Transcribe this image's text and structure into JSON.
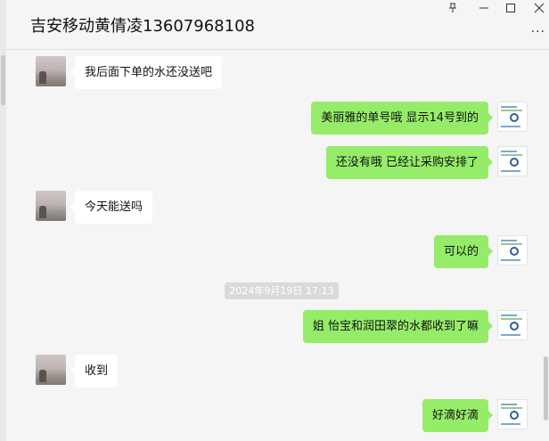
{
  "header": {
    "title": "吉安移动黄倩凌13607968108",
    "more_label": "···"
  },
  "window_controls": [
    "pin-icon",
    "minimize-icon",
    "maximize-icon",
    "close-icon"
  ],
  "messages": [
    {
      "side": "in",
      "text": "我后面下单的水还没送吧"
    },
    {
      "side": "out",
      "text": "美丽雅的单号哦 显示14号到的"
    },
    {
      "side": "out",
      "text": "还没有哦 已经让采购安排了"
    },
    {
      "side": "in",
      "text": "今天能送吗"
    },
    {
      "side": "out",
      "text": "可以的"
    },
    {
      "side": "out",
      "text": "姐  怡宝和润田翠的水都收到了嘛"
    },
    {
      "side": "in",
      "text": "收到"
    },
    {
      "side": "out",
      "text": "好滴好滴"
    }
  ],
  "timestamp": "2024年9月19日 17:13",
  "colors": {
    "background": "#f5f5f5",
    "bubble_out": "#95ec69",
    "bubble_in": "#ffffff",
    "timestamp_bg": "#dadada"
  }
}
